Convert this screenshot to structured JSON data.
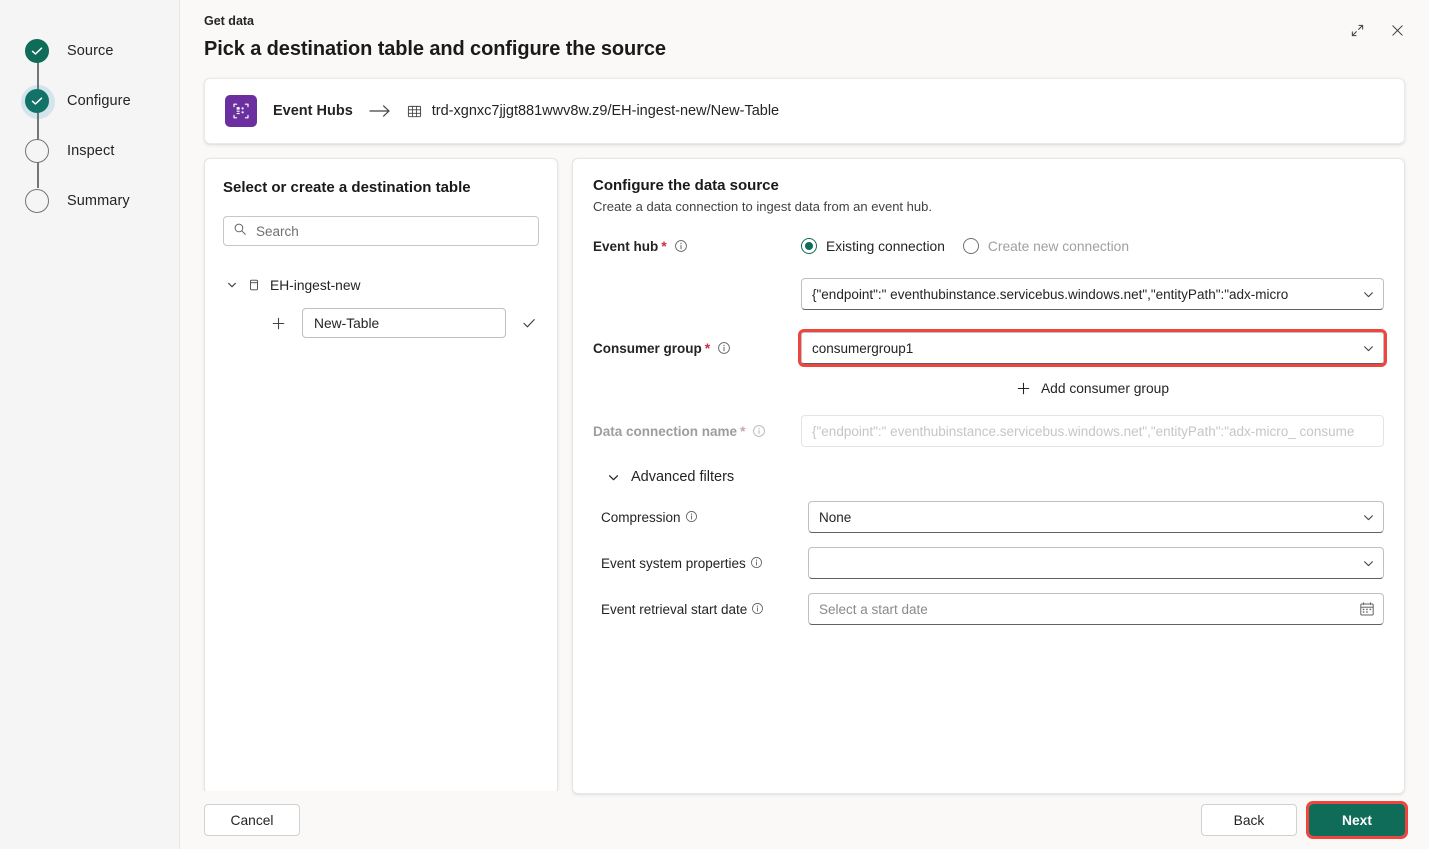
{
  "wizard": {
    "steps": [
      {
        "label": "Source",
        "state": "done"
      },
      {
        "label": "Configure",
        "state": "done-current"
      },
      {
        "label": "Inspect",
        "state": "todo"
      },
      {
        "label": "Summary",
        "state": "todo"
      }
    ]
  },
  "header": {
    "eyebrow": "Get data",
    "title": "Pick a destination table and configure the source",
    "expand_icon": "expand-icon",
    "close_icon": "close-icon"
  },
  "source_card": {
    "connector_icon": "event-hubs-icon",
    "connector_name": "Event Hubs",
    "arrow_icon": "arrow-right-icon",
    "table_icon": "table-icon",
    "destination_path": "trd-xgnxc7jjgt881wwv8w.z9/EH-ingest-new/New-Table"
  },
  "destination_panel": {
    "title": "Select or create a destination table",
    "search": {
      "icon": "search-icon",
      "placeholder": "Search",
      "value": ""
    },
    "tree": {
      "expand_icon": "chevron-down-icon",
      "database_icon": "database-icon",
      "database_name": "EH-ingest-new",
      "add_icon": "plus-icon",
      "new_table_value": "New-Table",
      "confirm_icon": "checkmark-icon"
    }
  },
  "configure_panel": {
    "title": "Configure the data source",
    "subtitle": "Create a data connection to ingest data from an event hub.",
    "event_hub": {
      "label": "Event hub",
      "required": "*",
      "info_icon": "info-icon",
      "options": [
        {
          "label": "Existing connection",
          "selected": true,
          "disabled": false
        },
        {
          "label": "Create new connection",
          "selected": false,
          "disabled": true
        }
      ],
      "connection_value": "{\"endpoint\":\"  eventhubinstance.servicebus.windows.net\",\"entityPath\":\"adx-micro",
      "caret_icon": "chevron-down-icon"
    },
    "consumer_group": {
      "label": "Consumer group",
      "required": "*",
      "info_icon": "info-icon",
      "value": "consumergroup1",
      "caret_icon": "chevron-down-icon",
      "highlighted": true,
      "highlight_color": "#f0443e"
    },
    "add_consumer_group": {
      "icon": "plus-icon",
      "label": "Add consumer group"
    },
    "data_connection_name": {
      "label": "Data connection name",
      "required": "*",
      "info_icon": "info-icon",
      "value": "{\"endpoint\":\"  eventhubinstance.servicebus.windows.net\",\"entityPath\":\"adx-micro_ consume",
      "disabled": true
    },
    "advanced_filters": {
      "toggle_icon": "chevron-down-icon",
      "label": "Advanced filters",
      "fields": [
        {
          "label": "Compression",
          "info_icon": "info-icon",
          "value": "None",
          "placeholder": "",
          "control": "dropdown",
          "caret_icon": "chevron-down-icon"
        },
        {
          "label": "Event system properties",
          "info_icon": "info-icon",
          "value": "",
          "placeholder": "",
          "control": "dropdown",
          "caret_icon": "chevron-down-icon"
        },
        {
          "label": "Event retrieval start date",
          "info_icon": "info-icon",
          "value": "",
          "placeholder": "Select a start date",
          "control": "datepicker",
          "caret_icon": "calendar-icon"
        }
      ]
    }
  },
  "footer": {
    "cancel_label": "Cancel",
    "back_label": "Back",
    "next_label": "Next",
    "next_highlighted": true,
    "next_highlight_color": "#f0443e"
  },
  "colors": {
    "accent": "#0f6c58",
    "connector_purple": "#6b2fa0",
    "required_red": "#c4314b",
    "highlight_red": "#f0443e"
  }
}
